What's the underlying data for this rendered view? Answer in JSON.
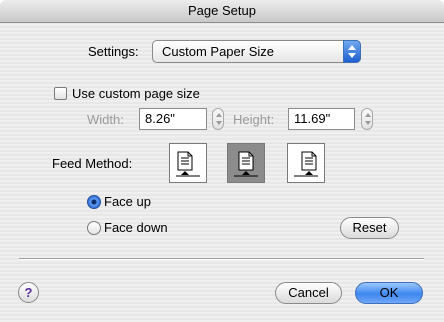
{
  "window": {
    "title": "Page Setup"
  },
  "settings": {
    "label": "Settings:",
    "selected": "Custom Paper Size"
  },
  "custom_size": {
    "checkbox_label": "Use custom page size",
    "checked": false,
    "width_label": "Width:",
    "width_value": "8.26\"",
    "height_label": "Height:",
    "height_value": "11.69\""
  },
  "feed": {
    "label": "Feed Method:",
    "options": [
      "feed-left",
      "feed-center",
      "feed-right"
    ],
    "selected_index": 1
  },
  "orientation": {
    "face_up": "Face up",
    "face_down": "Face down",
    "selected": "Face up"
  },
  "buttons": {
    "reset": "Reset",
    "help": "?",
    "cancel": "Cancel",
    "ok": "OK"
  },
  "colors": {
    "accent": "#3d87f0",
    "selected_feed_bg": "#8c8c8c",
    "help_glyph": "#5b2f9a"
  }
}
